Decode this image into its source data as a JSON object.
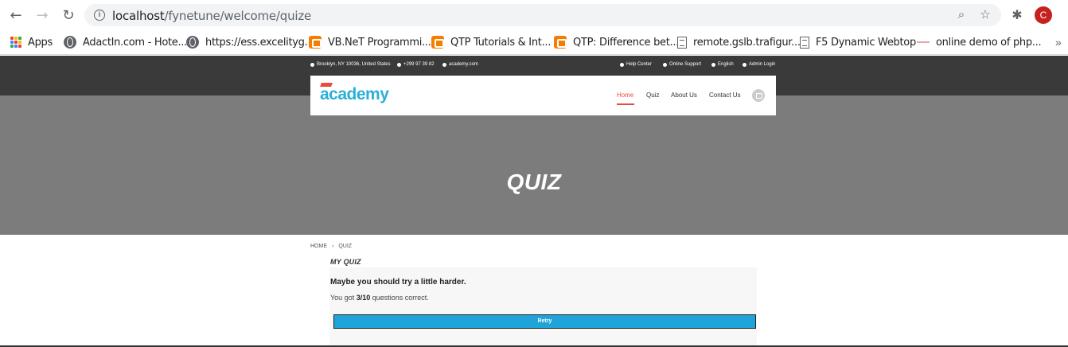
{
  "browser": {
    "url_host": "localhost",
    "url_path": "/fynetune/welcome/quize",
    "avatar_letter": "C"
  },
  "bookmarks": [
    {
      "label": "Apps",
      "icon": "apps-grid-icon"
    },
    {
      "label": "AdactIn.com - Hote...",
      "icon": "globe-icon"
    },
    {
      "label": "https://ess.excelityg...",
      "icon": "globe-icon"
    },
    {
      "label": "VB.NeT Programmi...",
      "icon": "blogger-icon"
    },
    {
      "label": "QTP Tutorials & Int...",
      "icon": "blogger-icon"
    },
    {
      "label": "QTP: Difference bet...",
      "icon": "blogger-icon"
    },
    {
      "label": "remote.gslb.trafigur...",
      "icon": "document-icon"
    },
    {
      "label": "F5 Dynamic Webtop",
      "icon": "document-icon"
    },
    {
      "label": "online demo of php...",
      "icon": "dash-icon"
    }
  ],
  "topbar": {
    "address": "Brooklyn, NY 10036, United States",
    "phone": "+299 97 39 82",
    "website": "academy.com",
    "help": "Help Center",
    "support": "Online Support",
    "language": "English",
    "admin": "Admin Login"
  },
  "site": {
    "logo": "academy",
    "nav": [
      "Home",
      "Quiz",
      "About Us",
      "Contact Us"
    ]
  },
  "hero": {
    "title": "QUIZ"
  },
  "breadcrumb": {
    "home": "HOME",
    "separator": "›",
    "current": "QUIZ"
  },
  "quiz": {
    "section_title": "MY QUIZ",
    "result_title": "Maybe you should try a little harder.",
    "result_prefix": "You got ",
    "score": "3/10",
    "result_suffix": " questions correct.",
    "retry_label": "Retry"
  },
  "colors": {
    "accent": "#e74c3c",
    "logo_blue": "#2ab0d8",
    "retry_blue": "#1ea4d8",
    "topbar": "#3a3a3a",
    "hero": "#7c7c7c"
  }
}
